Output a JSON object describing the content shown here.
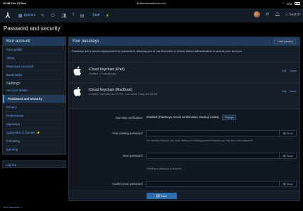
{
  "status_bar": {
    "time": "10:48",
    "date": "Thu 21 Nov",
    "url": "atomicacademia.com",
    "battery": "42%"
  },
  "nav": {
    "articles": "Articles",
    "staff": "Staff",
    "search": "Search"
  },
  "page_title": "Password and security",
  "sidebar": {
    "header": "Your account",
    "items_top": [
      "Your profile",
      "Alerts",
      "Reactions received",
      "Bookmarks"
    ],
    "settings_label": "Settings",
    "items_settings": [
      "Account details",
      "Password and security",
      "Privacy",
      "Preferences",
      "Signature",
      "Subscribe or Donate ✨",
      "Following",
      "Ignoring"
    ],
    "active_item": "Password and security",
    "logout": "Log out"
  },
  "footer": {
    "account_link": "Your account ˅"
  },
  "passkeys": {
    "title": "Your passkeys",
    "add_button": "+ Add passkey",
    "description": "Passkeys are a secure replacement for passwords, allowing you to use biometric or device-based authentication to access your account.",
    "items": [
      {
        "name": "iCloud Keychain (iPad)",
        "meta": "Created: 15 minutes ago",
        "edit": "Edit",
        "delete": "Delete"
      },
      {
        "name": "iCloud Keychain (MacBook)",
        "meta": "Created: Yesterday at 3:31 PM · Last used: Today at 9:58 AM",
        "edit": "Edit",
        "delete": "Delete"
      }
    ]
  },
  "form": {
    "two_step_label": "Two-step verification:",
    "two_step_value": "Enabled (Passkeys, Email confirmation, Backup codes)",
    "change_button": "Change",
    "existing_label": "Your existing password:",
    "existing_hint": "For security reasons, you must verify your existing password before you may set a new password.",
    "new_label": "New password:",
    "new_hint": "Entering a password is required.",
    "confirm_label": "Confirm new password:",
    "show_label": "Show",
    "save_button": "Save"
  }
}
